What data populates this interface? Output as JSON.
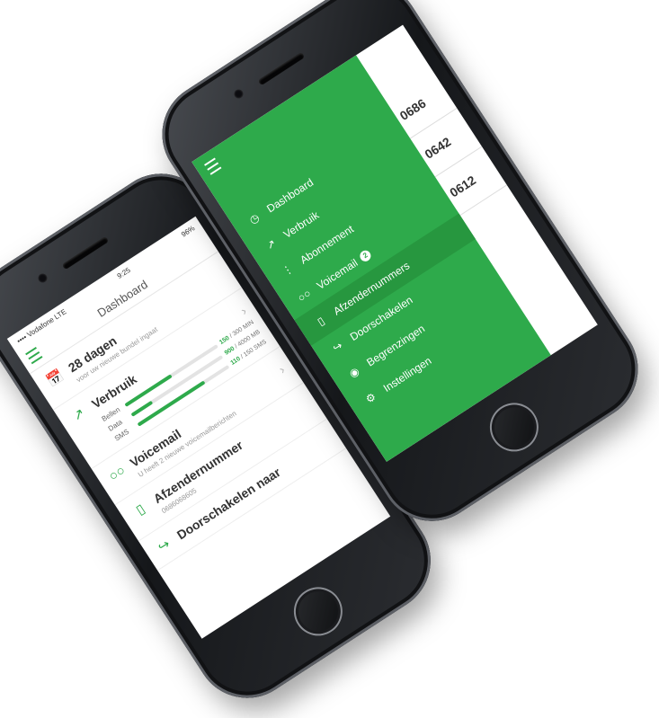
{
  "left_phone": {
    "status": {
      "carrier": "•••• Vodafone LTE",
      "time": "9:25",
      "battery": "96%"
    },
    "nav_title": "Dashboard",
    "days": {
      "title": "28 dagen",
      "subtitle": "voor uw nieuwe bundel ingaat"
    },
    "verbruik": {
      "title": "Verbruik",
      "rows": [
        {
          "label": "Bellen",
          "used": "150",
          "total": "/ 300 MIN",
          "fraction": 0.5
        },
        {
          "label": "Data",
          "used": "900",
          "total": "/ 4000 MB",
          "fraction": 0.225
        },
        {
          "label": "SMS",
          "used": "110",
          "total": "/ 150 SMS",
          "fraction": 0.73
        }
      ]
    },
    "voicemail": {
      "title": "Voicemail",
      "subtitle": "U heeft 2 nieuwe voicemailberichten"
    },
    "afzender": {
      "title": "Afzendernummer",
      "subtitle": "0686068605"
    },
    "doorschakelen": {
      "title": "Doorschakelen naar"
    }
  },
  "right_phone": {
    "menu_items": [
      {
        "label": "Dashboard",
        "icon": "dashboard-icon"
      },
      {
        "label": "Verbruik",
        "icon": "usage-icon"
      },
      {
        "label": "Abonnement",
        "icon": "subscription-icon"
      },
      {
        "label": "Voicemail",
        "icon": "voicemail-icon",
        "badge": "2"
      },
      {
        "label": "Afzendernummers",
        "icon": "phone-icon",
        "active": true
      },
      {
        "label": "Doorschakelen",
        "icon": "forward-icon"
      },
      {
        "label": "Begrenzingen",
        "icon": "limit-icon"
      },
      {
        "label": "Instellingen",
        "icon": "settings-icon"
      }
    ],
    "background_numbers": [
      "0686",
      "0642",
      "0612"
    ]
  },
  "colors": {
    "accent": "#2eaa4b",
    "accent_dark": "#27973f"
  }
}
